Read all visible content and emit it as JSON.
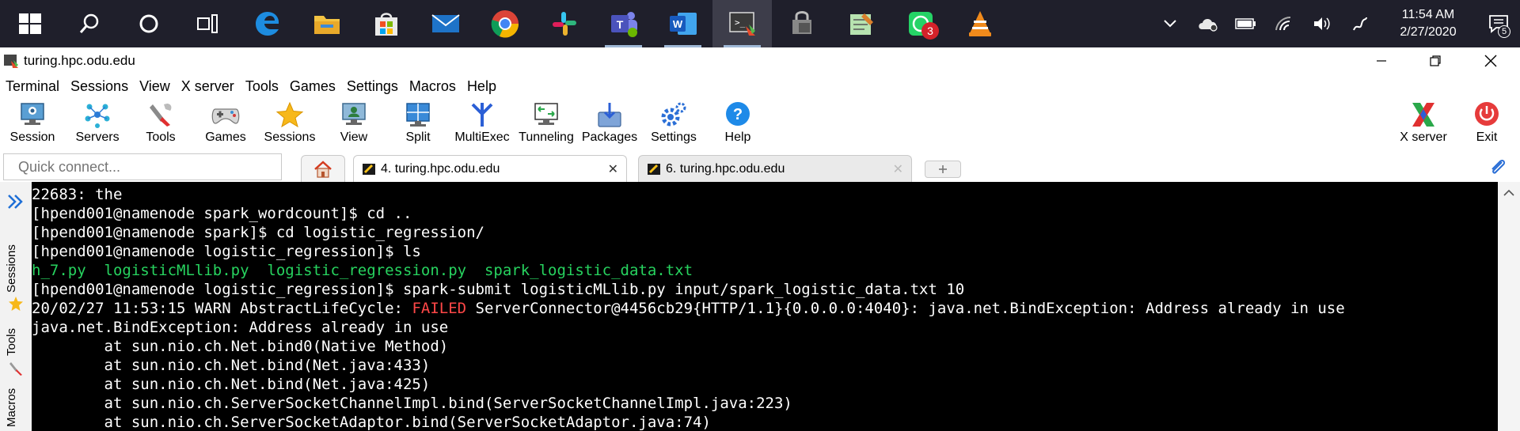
{
  "taskbar": {
    "icons": [
      {
        "name": "windows-start-icon"
      },
      {
        "name": "search-icon"
      },
      {
        "name": "cortana-icon"
      },
      {
        "name": "task-view-icon"
      },
      {
        "name": "edge-icon"
      },
      {
        "name": "file-explorer-icon"
      },
      {
        "name": "store-icon"
      },
      {
        "name": "mail-icon"
      },
      {
        "name": "chrome-icon"
      },
      {
        "name": "slack-icon"
      },
      {
        "name": "teams-icon"
      },
      {
        "name": "word-icon"
      },
      {
        "name": "mobaxterm-icon"
      },
      {
        "name": "ssh-tool-icon"
      },
      {
        "name": "notepad-icon"
      },
      {
        "name": "whatsapp-icon"
      },
      {
        "name": "vlc-icon"
      }
    ],
    "whatsapp_badge": "3",
    "clock_time": "11:54 AM",
    "clock_date": "2/27/2020",
    "notification_count": "5"
  },
  "window": {
    "title": "turing.hpc.odu.edu"
  },
  "menu": [
    "Terminal",
    "Sessions",
    "View",
    "X server",
    "Tools",
    "Games",
    "Settings",
    "Macros",
    "Help"
  ],
  "toolbar": {
    "session": "Session",
    "servers": "Servers",
    "tools": "Tools",
    "games": "Games",
    "sessions": "Sessions",
    "view": "View",
    "split": "Split",
    "multiexec": "MultiExec",
    "tunneling": "Tunneling",
    "packages": "Packages",
    "settings": "Settings",
    "help": "Help",
    "xserver": "X server",
    "exit": "Exit"
  },
  "tabs": {
    "quick_connect_placeholder": "Quick connect...",
    "tab1": "4. turing.hpc.odu.edu",
    "tab2": "6. turing.hpc.odu.edu",
    "close_glyph": "✕"
  },
  "sidebar": {
    "sessions": "Sessions",
    "tools": "Tools",
    "macros": "Macros"
  },
  "terminal": {
    "l1": "22683: the",
    "l2": "[hpend001@namenode spark_wordcount]$ cd ..",
    "l3": "[hpend001@namenode spark]$ cd logistic_regression/",
    "l4": "[hpend001@namenode logistic_regression]$ ls",
    "l5": "h_7.py  logisticMLlib.py  logistic_regression.py  spark_logistic_data.txt",
    "l6": "[hpend001@namenode logistic_regression]$ spark-submit logisticMLlib.py input/spark_logistic_data.txt 10",
    "l7a": "20/02/27 11:53:15 WARN AbstractLifeCycle: ",
    "l7b": "FAILED",
    "l7c": " ServerConnector@4456cb29{HTTP/1.1}{0.0.0.0:4040}: java.net.BindException: Address already in use",
    "l8": "java.net.BindException: Address already in use",
    "l9": "        at sun.nio.ch.Net.bind0(Native Method)",
    "l10": "        at sun.nio.ch.Net.bind(Net.java:433)",
    "l11": "        at sun.nio.ch.Net.bind(Net.java:425)",
    "l12": "        at sun.nio.ch.ServerSocketChannelImpl.bind(ServerSocketChannelImpl.java:223)",
    "l13": "        at sun.nio.ch.ServerSocketAdaptor.bind(ServerSocketAdaptor.java:74)"
  }
}
